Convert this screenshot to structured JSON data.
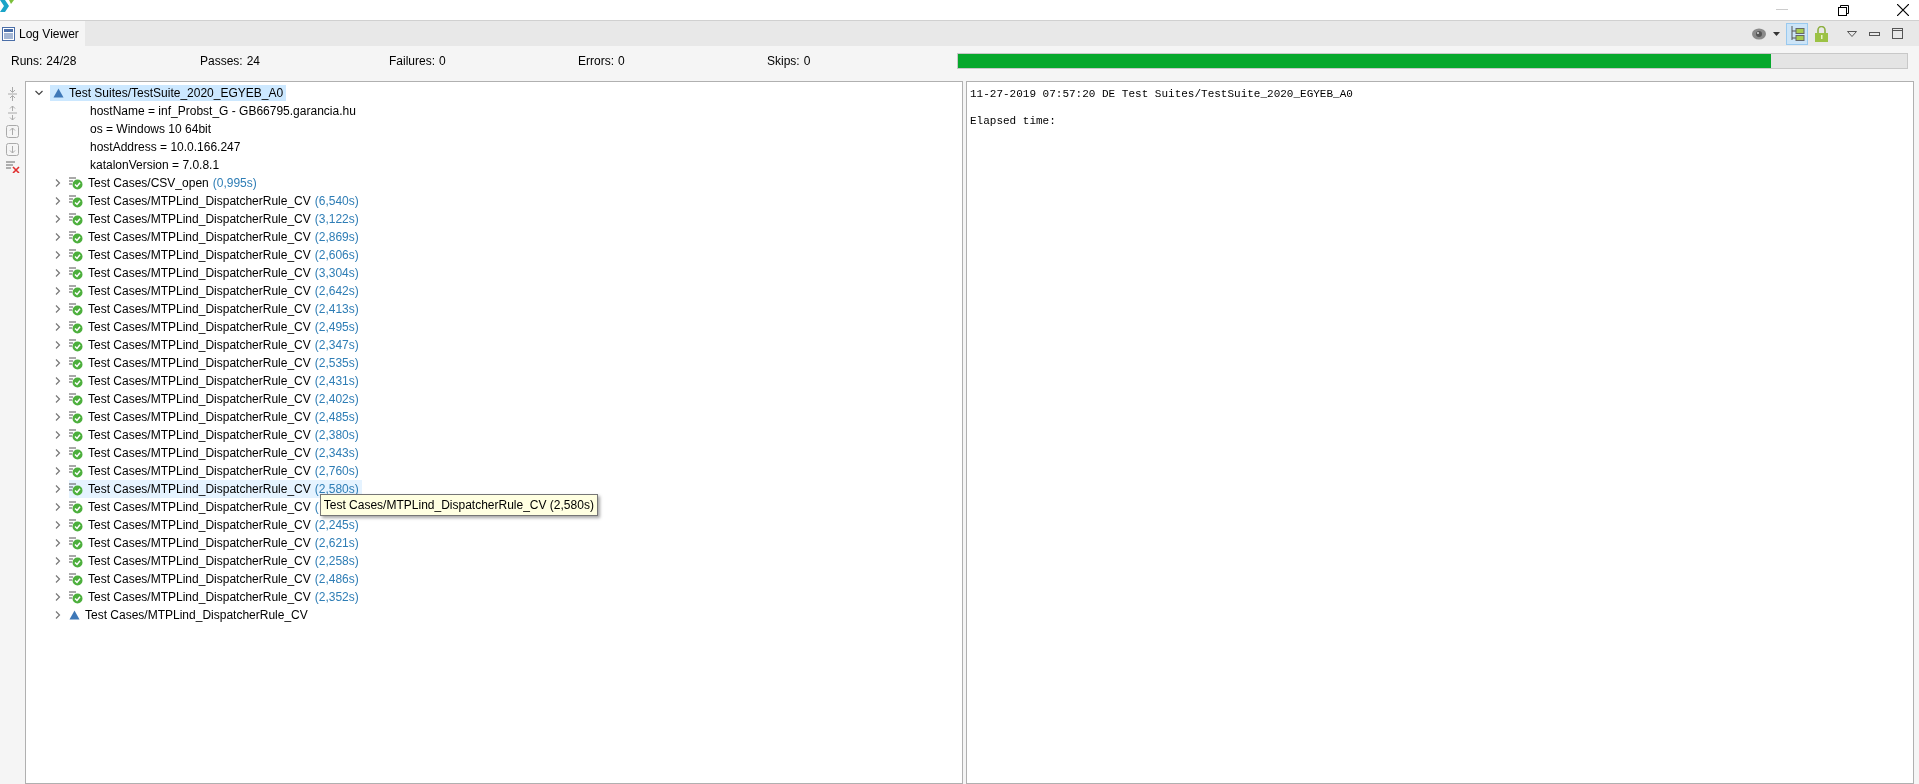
{
  "tab": {
    "title": "Log Viewer",
    "selected": true
  },
  "stats": [
    {
      "label": "Runs:",
      "value": "24/28"
    },
    {
      "label": "Passes:",
      "value": "24"
    },
    {
      "label": "Failures:",
      "value": "0"
    },
    {
      "label": "Errors:",
      "value": "0"
    },
    {
      "label": "Skips:",
      "value": "0"
    }
  ],
  "progress": {
    "level": 0.857
  },
  "view_toolbar": {
    "tree_view": {
      "selected": true
    }
  },
  "tree": {
    "label": "Test Suites/TestSuite_2020_EGYEB_A0",
    "kind": "incomplete",
    "selected": true,
    "expanded": true,
    "children": [
      {
        "kind": "property",
        "label": "hostName = inf_Probst_G - GB66795.garancia.hu"
      },
      {
        "kind": "property",
        "label": "os = Windows 10 64bit"
      },
      {
        "kind": "property",
        "label": "hostAddress = 10.0.166.247"
      },
      {
        "kind": "property",
        "label": "katalonVersion = 7.0.8.1"
      },
      {
        "kind": "passed_test",
        "label": "Test Cases/CSV_open",
        "duration": "(0,995s)",
        "expanded": false,
        "hovered": false
      },
      {
        "kind": "passed_test",
        "label": "Test Cases/MTPLind_DispatcherRule_CV",
        "duration": "(6,540s)",
        "expanded": false,
        "hovered": false
      },
      {
        "kind": "passed_test",
        "label": "Test Cases/MTPLind_DispatcherRule_CV",
        "duration": "(3,122s)",
        "expanded": false,
        "hovered": false
      },
      {
        "kind": "passed_test",
        "label": "Test Cases/MTPLind_DispatcherRule_CV",
        "duration": "(2,869s)",
        "expanded": false,
        "hovered": false
      },
      {
        "kind": "passed_test",
        "label": "Test Cases/MTPLind_DispatcherRule_CV",
        "duration": "(2,606s)",
        "expanded": false,
        "hovered": false
      },
      {
        "kind": "passed_test",
        "label": "Test Cases/MTPLind_DispatcherRule_CV",
        "duration": "(3,304s)",
        "expanded": false,
        "hovered": false
      },
      {
        "kind": "passed_test",
        "label": "Test Cases/MTPLind_DispatcherRule_CV",
        "duration": "(2,642s)",
        "expanded": false,
        "hovered": false
      },
      {
        "kind": "passed_test",
        "label": "Test Cases/MTPLind_DispatcherRule_CV",
        "duration": "(2,413s)",
        "expanded": false,
        "hovered": false
      },
      {
        "kind": "passed_test",
        "label": "Test Cases/MTPLind_DispatcherRule_CV",
        "duration": "(2,495s)",
        "expanded": false,
        "hovered": false
      },
      {
        "kind": "passed_test",
        "label": "Test Cases/MTPLind_DispatcherRule_CV",
        "duration": "(2,347s)",
        "expanded": false,
        "hovered": false
      },
      {
        "kind": "passed_test",
        "label": "Test Cases/MTPLind_DispatcherRule_CV",
        "duration": "(2,535s)",
        "expanded": false,
        "hovered": false
      },
      {
        "kind": "passed_test",
        "label": "Test Cases/MTPLind_DispatcherRule_CV",
        "duration": "(2,431s)",
        "expanded": false,
        "hovered": false
      },
      {
        "kind": "passed_test",
        "label": "Test Cases/MTPLind_DispatcherRule_CV",
        "duration": "(2,402s)",
        "expanded": false,
        "hovered": false
      },
      {
        "kind": "passed_test",
        "label": "Test Cases/MTPLind_DispatcherRule_CV",
        "duration": "(2,485s)",
        "expanded": false,
        "hovered": false
      },
      {
        "kind": "passed_test",
        "label": "Test Cases/MTPLind_DispatcherRule_CV",
        "duration": "(2,380s)",
        "expanded": false,
        "hovered": false
      },
      {
        "kind": "passed_test",
        "label": "Test Cases/MTPLind_DispatcherRule_CV",
        "duration": "(2,343s)",
        "expanded": false,
        "hovered": false
      },
      {
        "kind": "passed_test",
        "label": "Test Cases/MTPLind_DispatcherRule_CV",
        "duration": "(2,760s)",
        "expanded": false,
        "hovered": false
      },
      {
        "kind": "passed_test",
        "label": "Test Cases/MTPLind_DispatcherRule_CV",
        "duration": "(2,580s)",
        "expanded": false,
        "hovered": true
      },
      {
        "kind": "passed_test",
        "label": "Test Cases/MTPLind_DispatcherRule_CV",
        "duration": "(",
        "expanded": false,
        "hovered": false,
        "tooltip": "Test Cases/MTPLind_DispatcherRule_CV (2,580s)"
      },
      {
        "kind": "passed_test",
        "label": "Test Cases/MTPLind_DispatcherRule_CV",
        "duration": "(2,245s)",
        "expanded": false,
        "hovered": false
      },
      {
        "kind": "passed_test",
        "label": "Test Cases/MTPLind_DispatcherRule_CV",
        "duration": "(2,621s)",
        "expanded": false,
        "hovered": false
      },
      {
        "kind": "passed_test",
        "label": "Test Cases/MTPLind_DispatcherRule_CV",
        "duration": "(2,258s)",
        "expanded": false,
        "hovered": false
      },
      {
        "kind": "passed_test",
        "label": "Test Cases/MTPLind_DispatcherRule_CV",
        "duration": "(2,486s)",
        "expanded": false,
        "hovered": false
      },
      {
        "kind": "passed_test",
        "label": "Test Cases/MTPLind_DispatcherRule_CV",
        "duration": "(2,352s)",
        "expanded": false,
        "hovered": false
      },
      {
        "kind": "incomplete_test",
        "label": "Test Cases/MTPLind_DispatcherRule_CV",
        "expanded": false,
        "hovered": false
      }
    ]
  },
  "log": {
    "lines": [
      "11-27-2019 07:57:20 DE Test Suites/TestSuite_2020_EGYEB_A0",
      "Elapsed time:"
    ]
  }
}
